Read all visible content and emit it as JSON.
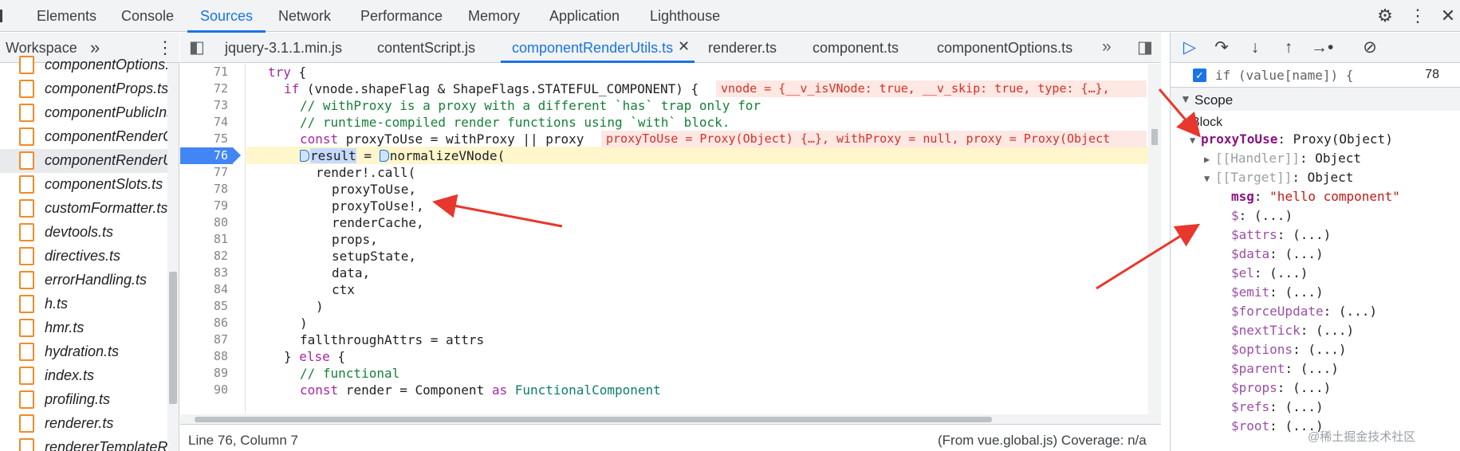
{
  "panel_tabs": [
    "Elements",
    "Console",
    "Sources",
    "Network",
    "Performance",
    "Memory",
    "Application",
    "Lighthouse"
  ],
  "active_panel": "Sources",
  "top_icons": [
    "gear-icon",
    "kebab-menu-icon",
    "close-icon"
  ],
  "navigator": {
    "header": "Workspace",
    "files": [
      "componentOptions.ts",
      "componentProps.ts",
      "componentPublicInstance.ts",
      "componentRenderContext.ts",
      "componentRenderUtils.ts",
      "componentSlots.ts",
      "customFormatter.ts",
      "devtools.ts",
      "directives.ts",
      "errorHandling.ts",
      "h.ts",
      "hmr.ts",
      "hydration.ts",
      "index.ts",
      "profiling.ts",
      "renderer.ts",
      "rendererTemplateRef.ts"
    ],
    "selected_file": "componentRenderUtils.ts"
  },
  "editor_tabs": [
    "jquery-3.1.1.min.js",
    "contentScript.js",
    "componentRenderUtils.ts",
    "renderer.ts",
    "component.ts",
    "componentOptions.ts"
  ],
  "active_editor_tab": "componentRenderUtils.ts",
  "code": {
    "paused_line": "76",
    "lines": [
      {
        "n": "71",
        "text": "try {"
      },
      {
        "n": "72",
        "text": "if (vnode.shapeFlag & ShapeFlags.STATEFUL_COMPONENT) {"
      },
      {
        "n": "73",
        "text": "// withProxy is a proxy with a different `has` trap only for"
      },
      {
        "n": "74",
        "text": "// runtime-compiled render functions using `with` block."
      },
      {
        "n": "75",
        "text": "const proxyToUse = withProxy || proxy"
      },
      {
        "n": "76",
        "text": "result = normalizeVNode("
      },
      {
        "n": "77",
        "text": "render!.call("
      },
      {
        "n": "78",
        "text": "proxyToUse,"
      },
      {
        "n": "79",
        "text": "proxyToUse!,"
      },
      {
        "n": "80",
        "text": "renderCache,"
      },
      {
        "n": "81",
        "text": "props,"
      },
      {
        "n": "82",
        "text": "setupState,"
      },
      {
        "n": "83",
        "text": "data,"
      },
      {
        "n": "84",
        "text": "ctx"
      },
      {
        "n": "85",
        "text": ")"
      },
      {
        "n": "86",
        "text": ")"
      },
      {
        "n": "87",
        "text": "fallthroughAttrs = attrs"
      },
      {
        "n": "88",
        "text": "} else {"
      },
      {
        "n": "89",
        "text": "// functional"
      },
      {
        "n": "90",
        "text": "const render = Component as FunctionalComponent"
      }
    ],
    "inline_values": {
      "line72": "vnode = {__v_isVNode: true, __v_skip: true, type: {…},",
      "line75": "proxyToUse = Proxy(Object) {…}, withProxy = null, proxy = Proxy(Object"
    }
  },
  "status": {
    "position": "Line 76, Column 7",
    "source": "(From vue.global.js) Coverage: n/a"
  },
  "debugger": {
    "breakpoint": {
      "code": "if (value[name]) {",
      "line": "78",
      "checked": true
    },
    "scope_title": "Scope",
    "block_title": "Block",
    "var": {
      "name": "proxyToUse",
      "value": "Proxy(Object)"
    },
    "handler": {
      "name": "[[Handler]]",
      "value": "Object"
    },
    "target": {
      "name": "[[Target]]",
      "value": "Object"
    },
    "msg": {
      "name": "msg",
      "value": "\"hello component\""
    },
    "props": [
      "$",
      "$attrs",
      "$data",
      "$el",
      "$emit",
      "$forceUpdate",
      "$nextTick",
      "$options",
      "$parent",
      "$props",
      "$refs",
      "$root"
    ],
    "getter_value": "(...)"
  },
  "watermark": "@稀土掘金技术社区",
  "colors": {
    "accent": "#1a73e8",
    "arrow": "#e8372c",
    "paused_line_bg": "#fff6cc"
  }
}
